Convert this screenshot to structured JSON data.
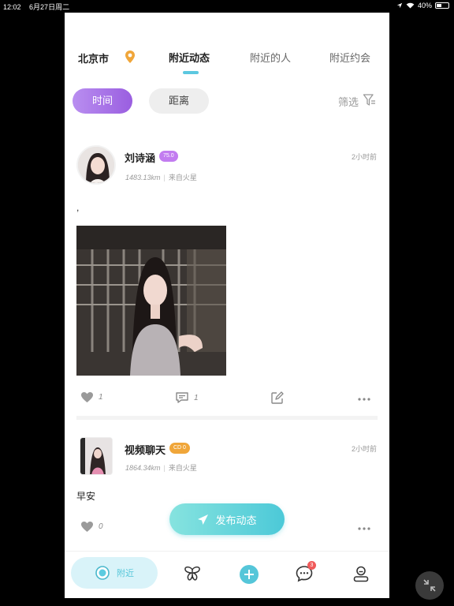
{
  "status_bar": {
    "time": "12:02",
    "date": "6月27日周二",
    "battery": "40%",
    "battery_level": 0.4
  },
  "header": {
    "city": "北京市",
    "tabs": [
      {
        "label": "附近动态",
        "active": true
      },
      {
        "label": "附近的人",
        "active": false
      },
      {
        "label": "附近约会",
        "active": false
      }
    ]
  },
  "filters": {
    "sort_options": [
      {
        "label": "时间",
        "active": true
      },
      {
        "label": "距离",
        "active": false
      }
    ],
    "screen_label": "筛选"
  },
  "posts": [
    {
      "username": "刘诗涵",
      "badge": "75.0",
      "badge_color": "#c27cf0",
      "time": "2小时前",
      "distance": "1483.13km",
      "origin": "来自火星",
      "text": ",",
      "likes": "1",
      "comments": "1"
    },
    {
      "username": "视频聊天",
      "badge": "CD 0",
      "badge_color": "#f0a63a",
      "time": "2小时前",
      "distance": "1864.34km",
      "origin": "来自火星",
      "text": "早安",
      "likes": "0"
    }
  ],
  "publish_button": "发布动态",
  "tab_bar": {
    "nearby_label": "附近",
    "message_badge": "3"
  },
  "colors": {
    "accent_purple": "#9a5ee0",
    "accent_cyan": "#4cc9d8",
    "location_orange": "#f0a63a"
  }
}
